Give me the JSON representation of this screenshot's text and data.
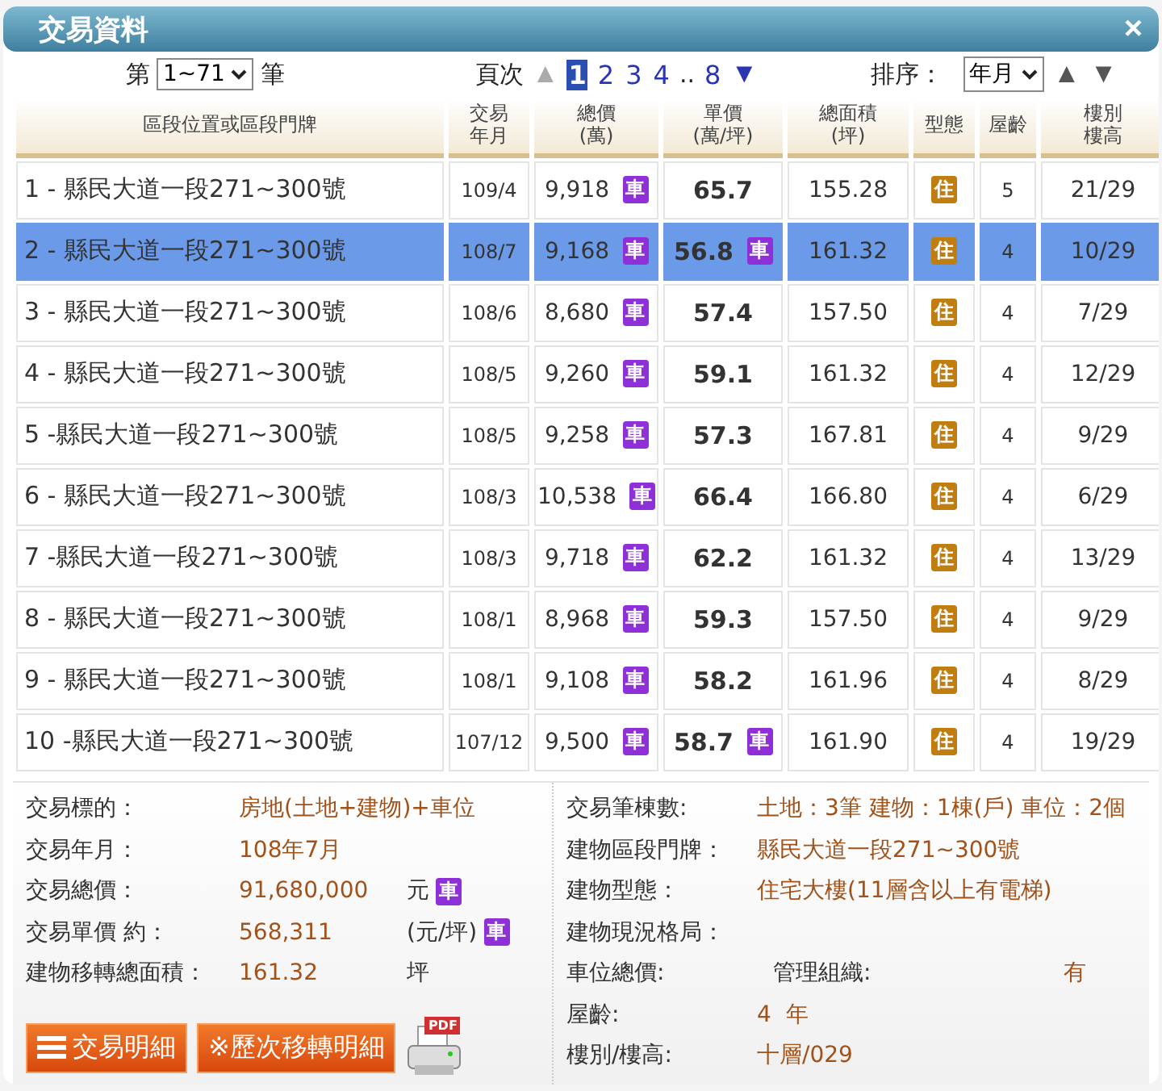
{
  "window": {
    "title": "交易資料",
    "close": "×"
  },
  "controls": {
    "range_prefix": "第",
    "range_value": "1~71",
    "range_suffix": "筆",
    "page_label": "頁次",
    "prev": "▲",
    "prev_disabled": true,
    "pages": [
      {
        "label": "1",
        "selected": true
      },
      {
        "label": "2",
        "selected": false
      },
      {
        "label": "3",
        "selected": false
      },
      {
        "label": "4",
        "selected": false
      }
    ],
    "ellipsis": "..",
    "last_page": "8",
    "next": "▼",
    "sort_label": "排序：",
    "sort_value": "年月",
    "sort_up": "▲",
    "sort_down": "▼"
  },
  "table": {
    "columns": [
      [
        "區段位置或區段門牌"
      ],
      [
        "交易",
        "年月"
      ],
      [
        "總價",
        "(萬)"
      ],
      [
        "單價",
        "(萬/坪)"
      ],
      [
        "總面積",
        "(坪)"
      ],
      [
        "型態"
      ],
      [
        "屋齡"
      ],
      [
        "樓別",
        "樓高"
      ]
    ],
    "rows": [
      {
        "address": "1 - 縣民大道一段271~300號",
        "date": "109/4",
        "total": "9,918",
        "total_badge": "車",
        "unit": "65.7",
        "area": "155.28",
        "type": "住",
        "age": "5",
        "floor": "21/29",
        "selected": false
      },
      {
        "address": "2 - 縣民大道一段271~300號",
        "date": "108/7",
        "total": "9,168",
        "total_badge": "車",
        "unit": "56.8",
        "unit_badge": "車",
        "area": "161.32",
        "type": "住",
        "age": "4",
        "floor": "10/29",
        "selected": true
      },
      {
        "address": "3 - 縣民大道一段271~300號",
        "date": "108/6",
        "total": "8,680",
        "total_badge": "車",
        "unit": "57.4",
        "area": "157.50",
        "type": "住",
        "age": "4",
        "floor": "7/29",
        "selected": false
      },
      {
        "address": "4 - 縣民大道一段271~300號",
        "date": "108/5",
        "total": "9,260",
        "total_badge": "車",
        "unit": "59.1",
        "area": "161.32",
        "type": "住",
        "age": "4",
        "floor": "12/29",
        "selected": false
      },
      {
        "address": "5 -縣民大道一段271~300號",
        "date": "108/5",
        "total": "9,258",
        "total_badge": "車",
        "unit": "57.3",
        "area": "167.81",
        "type": "住",
        "age": "4",
        "floor": "9/29",
        "selected": false
      },
      {
        "address": "6 - 縣民大道一段271~300號",
        "date": "108/3",
        "total": "10,538",
        "total_badge": "車",
        "unit": "66.4",
        "area": "166.80",
        "type": "住",
        "age": "4",
        "floor": "6/29",
        "selected": false
      },
      {
        "address": "7 -縣民大道一段271~300號",
        "date": "108/3",
        "total": "9,718",
        "total_badge": "車",
        "unit": "62.2",
        "area": "161.32",
        "type": "住",
        "age": "4",
        "floor": "13/29",
        "selected": false
      },
      {
        "address": "8 - 縣民大道一段271~300號",
        "date": "108/1",
        "total": "8,968",
        "total_badge": "車",
        "unit": "59.3",
        "area": "157.50",
        "type": "住",
        "age": "4",
        "floor": "9/29",
        "selected": false
      },
      {
        "address": "9 - 縣民大道一段271~300號",
        "date": "108/1",
        "total": "9,108",
        "total_badge": "車",
        "unit": "58.2",
        "area": "161.96",
        "type": "住",
        "age": "4",
        "floor": "8/29",
        "selected": false
      },
      {
        "address": "10 -縣民大道一段271~300號",
        "date": "107/12",
        "total": "9,500",
        "total_badge": "車",
        "unit": "58.7",
        "unit_badge": "車",
        "area": "161.90",
        "type": "住",
        "age": "4",
        "floor": "19/29",
        "selected": false
      }
    ]
  },
  "details_left": [
    {
      "label": "交易標的：",
      "value": "房地(土地+建物)+車位"
    },
    {
      "label": "交易年月：",
      "value": "108年7月"
    },
    {
      "label": "交易總價：",
      "value": "91,680,000",
      "unit": "元",
      "badge": "車"
    },
    {
      "label": "交易單價 約：",
      "value": "568,311",
      "unit": "(元/坪)",
      "badge": "車"
    },
    {
      "label": "建物移轉總面積：",
      "value": "161.32",
      "unit": "坪"
    }
  ],
  "details_right": [
    {
      "label": "交易筆棟數:",
      "value": "土地：3筆 建物：1棟(戶) 車位：2個"
    },
    {
      "label": "建物區段門牌：",
      "value": "縣民大道一段271~300號"
    },
    {
      "label": "建物型態：",
      "value": "住宅大樓(11層含以上有電梯)"
    },
    {
      "label": "建物現況格局："
    },
    {
      "label": "車位總價:",
      "extra_label": "管理組織:",
      "extra_value": "有"
    },
    {
      "label": "屋齡:",
      "value": "4  年"
    },
    {
      "label": "樓別/樓高:",
      "value": "十層/029"
    }
  ],
  "buttons": [
    {
      "kind": "list",
      "label": "交易明細"
    },
    {
      "kind": "plain",
      "label": "※歷次移轉明細"
    }
  ],
  "print": {
    "tag": "PDF"
  }
}
